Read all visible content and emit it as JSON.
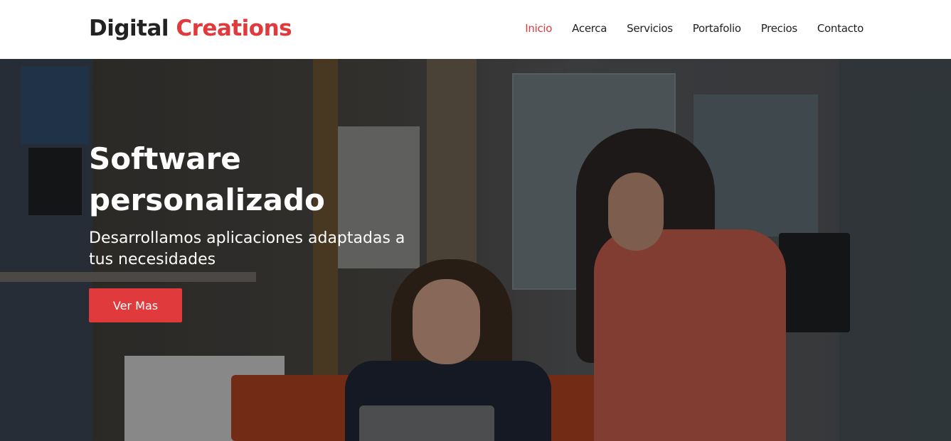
{
  "brand": {
    "name_part1": "Digital",
    "name_part2": "Creations"
  },
  "nav": {
    "items": [
      {
        "label": "Inicio"
      },
      {
        "label": "Acerca"
      },
      {
        "label": "Servicios"
      },
      {
        "label": "Portafolio"
      },
      {
        "label": "Precios"
      },
      {
        "label": "Contacto"
      }
    ],
    "active_index": 0
  },
  "hero": {
    "title": "Software personalizado",
    "subtitle": "Desarrollamos aplicaciones adaptadas a tus necesidades",
    "cta_label": "Ver Mas"
  },
  "colors": {
    "accent": "#e03a3c",
    "text_dark": "#222222",
    "header_bg": "#ffffff"
  }
}
